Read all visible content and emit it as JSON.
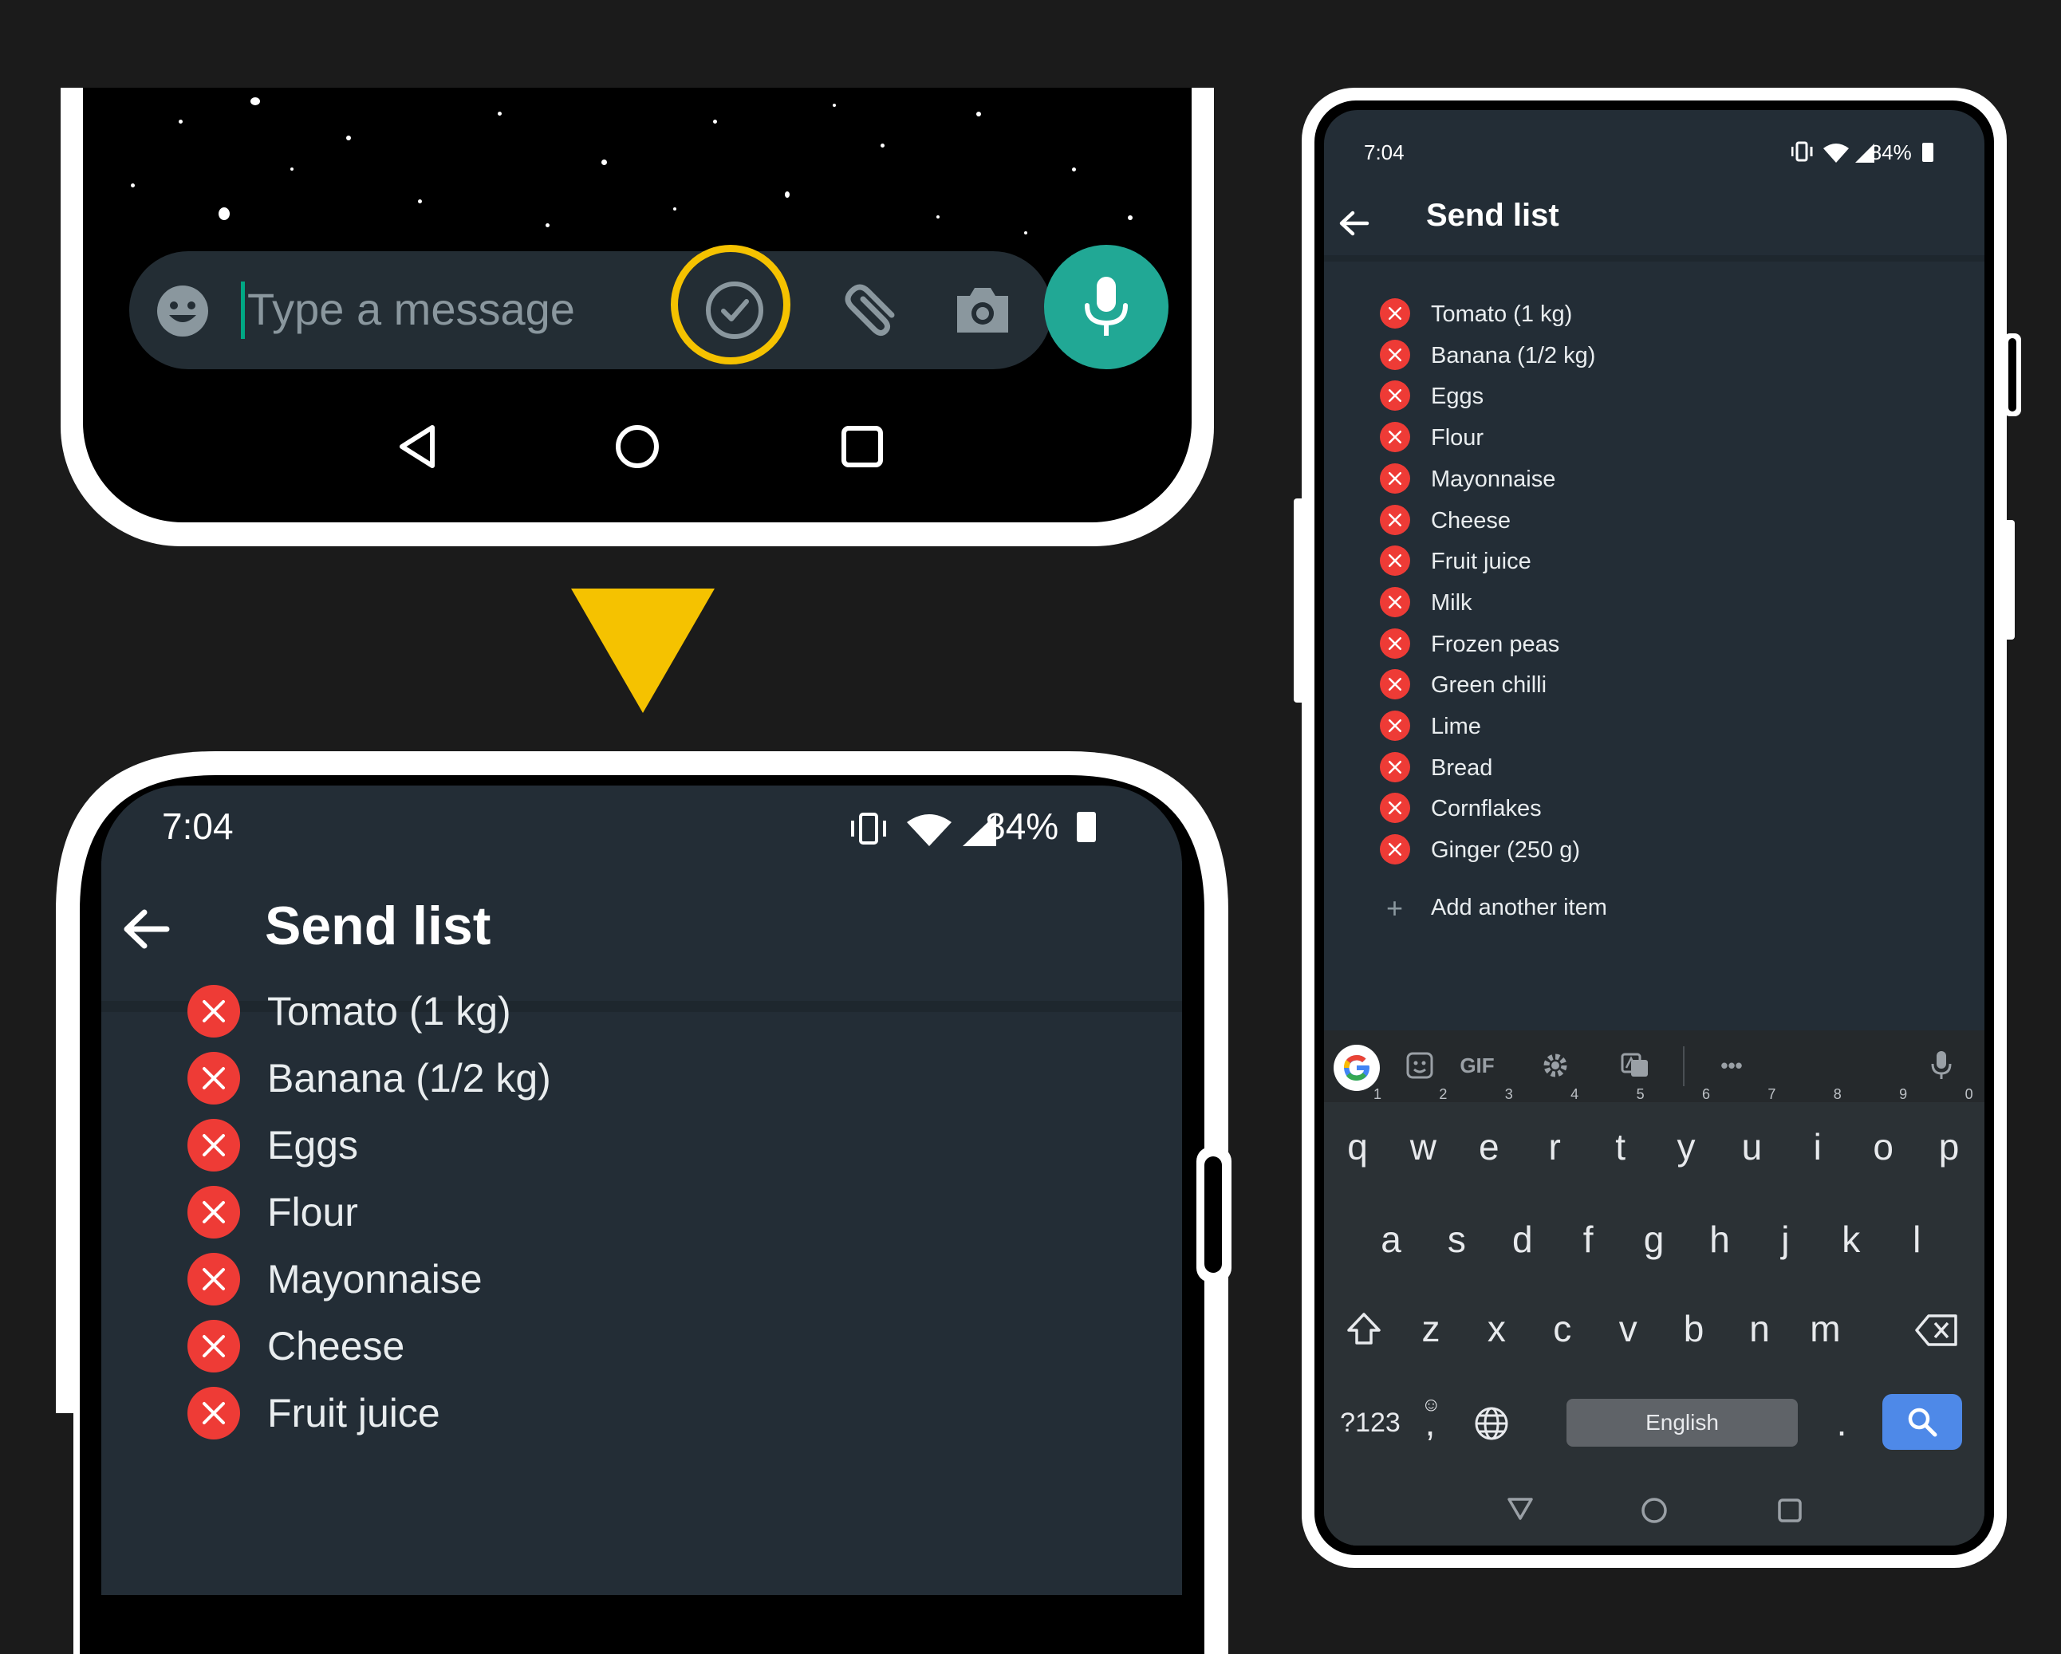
{
  "chat_input": {
    "placeholder": "Type a message",
    "icons": [
      "emoji-icon",
      "checklist-icon",
      "attachment-icon",
      "camera-icon",
      "microphone-icon"
    ],
    "highlight_color": "#f5c200",
    "send_button_color": "#21a895"
  },
  "status_bar": {
    "time": "7:04",
    "battery": "84%"
  },
  "send_list": {
    "title": "Send list",
    "items": [
      "Tomato (1 kg)",
      "Banana (1/2 kg)",
      "Eggs",
      "Flour",
      "Mayonnaise",
      "Cheese",
      "Fruit juice",
      "Milk",
      "Frozen peas",
      "Green chilli",
      "Lime",
      "Bread",
      "Cornflakes",
      "Ginger (250 g)"
    ],
    "add_label": "Add another item",
    "remove_color": "#ee3b36"
  },
  "keyboard": {
    "toolbar": {
      "gif_label": "GIF",
      "more_label": "•••"
    },
    "row1": [
      {
        "k": "q",
        "h": "1"
      },
      {
        "k": "w",
        "h": "2"
      },
      {
        "k": "e",
        "h": "3"
      },
      {
        "k": "r",
        "h": "4"
      },
      {
        "k": "t",
        "h": "5"
      },
      {
        "k": "y",
        "h": "6"
      },
      {
        "k": "u",
        "h": "7"
      },
      {
        "k": "i",
        "h": "8"
      },
      {
        "k": "o",
        "h": "9"
      },
      {
        "k": "p",
        "h": "0"
      }
    ],
    "row2": [
      "a",
      "s",
      "d",
      "f",
      "g",
      "h",
      "j",
      "k",
      "l"
    ],
    "row3": [
      "z",
      "x",
      "c",
      "v",
      "b",
      "n",
      "m"
    ],
    "symbols_label": "?123",
    "emoji_comma": ",",
    "space_label": "English",
    "period_label": "."
  },
  "arrow_color": "#f5c200"
}
